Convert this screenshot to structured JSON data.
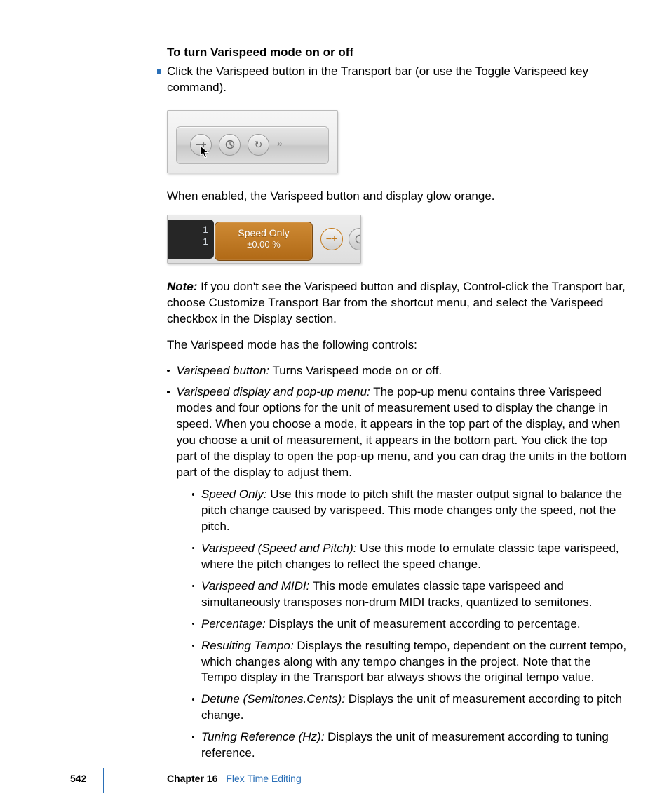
{
  "heading": "To turn Varispeed mode on or off",
  "bullet1": "Click the Varispeed button in the Transport bar (or use the Toggle Varispeed key command).",
  "afterFig1": "When enabled, the Varispeed button and display glow orange.",
  "display": {
    "line1": "1",
    "line2": "1",
    "mode": "Speed Only",
    "value": "±0.00 %"
  },
  "noteLabel": "Note:",
  "noteText": " If you don't see the Varispeed button and display, Control-click the Transport bar, choose Customize Transport Bar from the shortcut menu, and select the Varispeed checkbox in the Display section.",
  "controlsIntro": "The Varispeed mode has the following controls:",
  "controls": [
    {
      "term": "Varispeed button:",
      "desc": " Turns Varispeed mode on or off."
    },
    {
      "term": "Varispeed display and pop-up menu:",
      "desc": " The pop-up menu contains three Varispeed modes and four options for the unit of measurement used to display the change in speed. When you choose a mode, it appears in the top part of the display, and when you choose a unit of measurement, it appears in the bottom part. You click the top part of the display to open the pop-up menu, and you can drag the units in the bottom part of the display to adjust them."
    }
  ],
  "subControls": [
    {
      "term": "Speed Only:",
      "desc": " Use this mode to pitch shift the master output signal to balance the pitch change caused by varispeed. This mode changes only the speed, not the pitch."
    },
    {
      "term": "Varispeed (Speed and Pitch):",
      "desc": " Use this mode to emulate classic tape varispeed, where the pitch changes to reflect the speed change."
    },
    {
      "term": "Varispeed and MIDI:",
      "desc": " This mode emulates classic tape varispeed and simultaneously transposes non-drum MIDI tracks, quantized to semitones."
    },
    {
      "term": "Percentage:",
      "desc": " Displays the unit of measurement according to percentage."
    },
    {
      "term": "Resulting Tempo:",
      "desc": " Displays the resulting tempo, dependent on the current tempo, which changes along with any tempo changes in the project. Note that the Tempo display in the Transport bar always shows the original tempo value."
    },
    {
      "term": "Detune (Semitones.Cents):",
      "desc": " Displays the unit of measurement according to pitch change."
    },
    {
      "term": "Tuning Reference (Hz):",
      "desc": " Displays the unit of measurement according to tuning reference."
    }
  ],
  "footer": {
    "page": "542",
    "chapter": "Chapter 16",
    "title": "Flex Time Editing"
  },
  "glyph": {
    "plusminus": "−+",
    "loop": "↻",
    "chev": "»"
  }
}
